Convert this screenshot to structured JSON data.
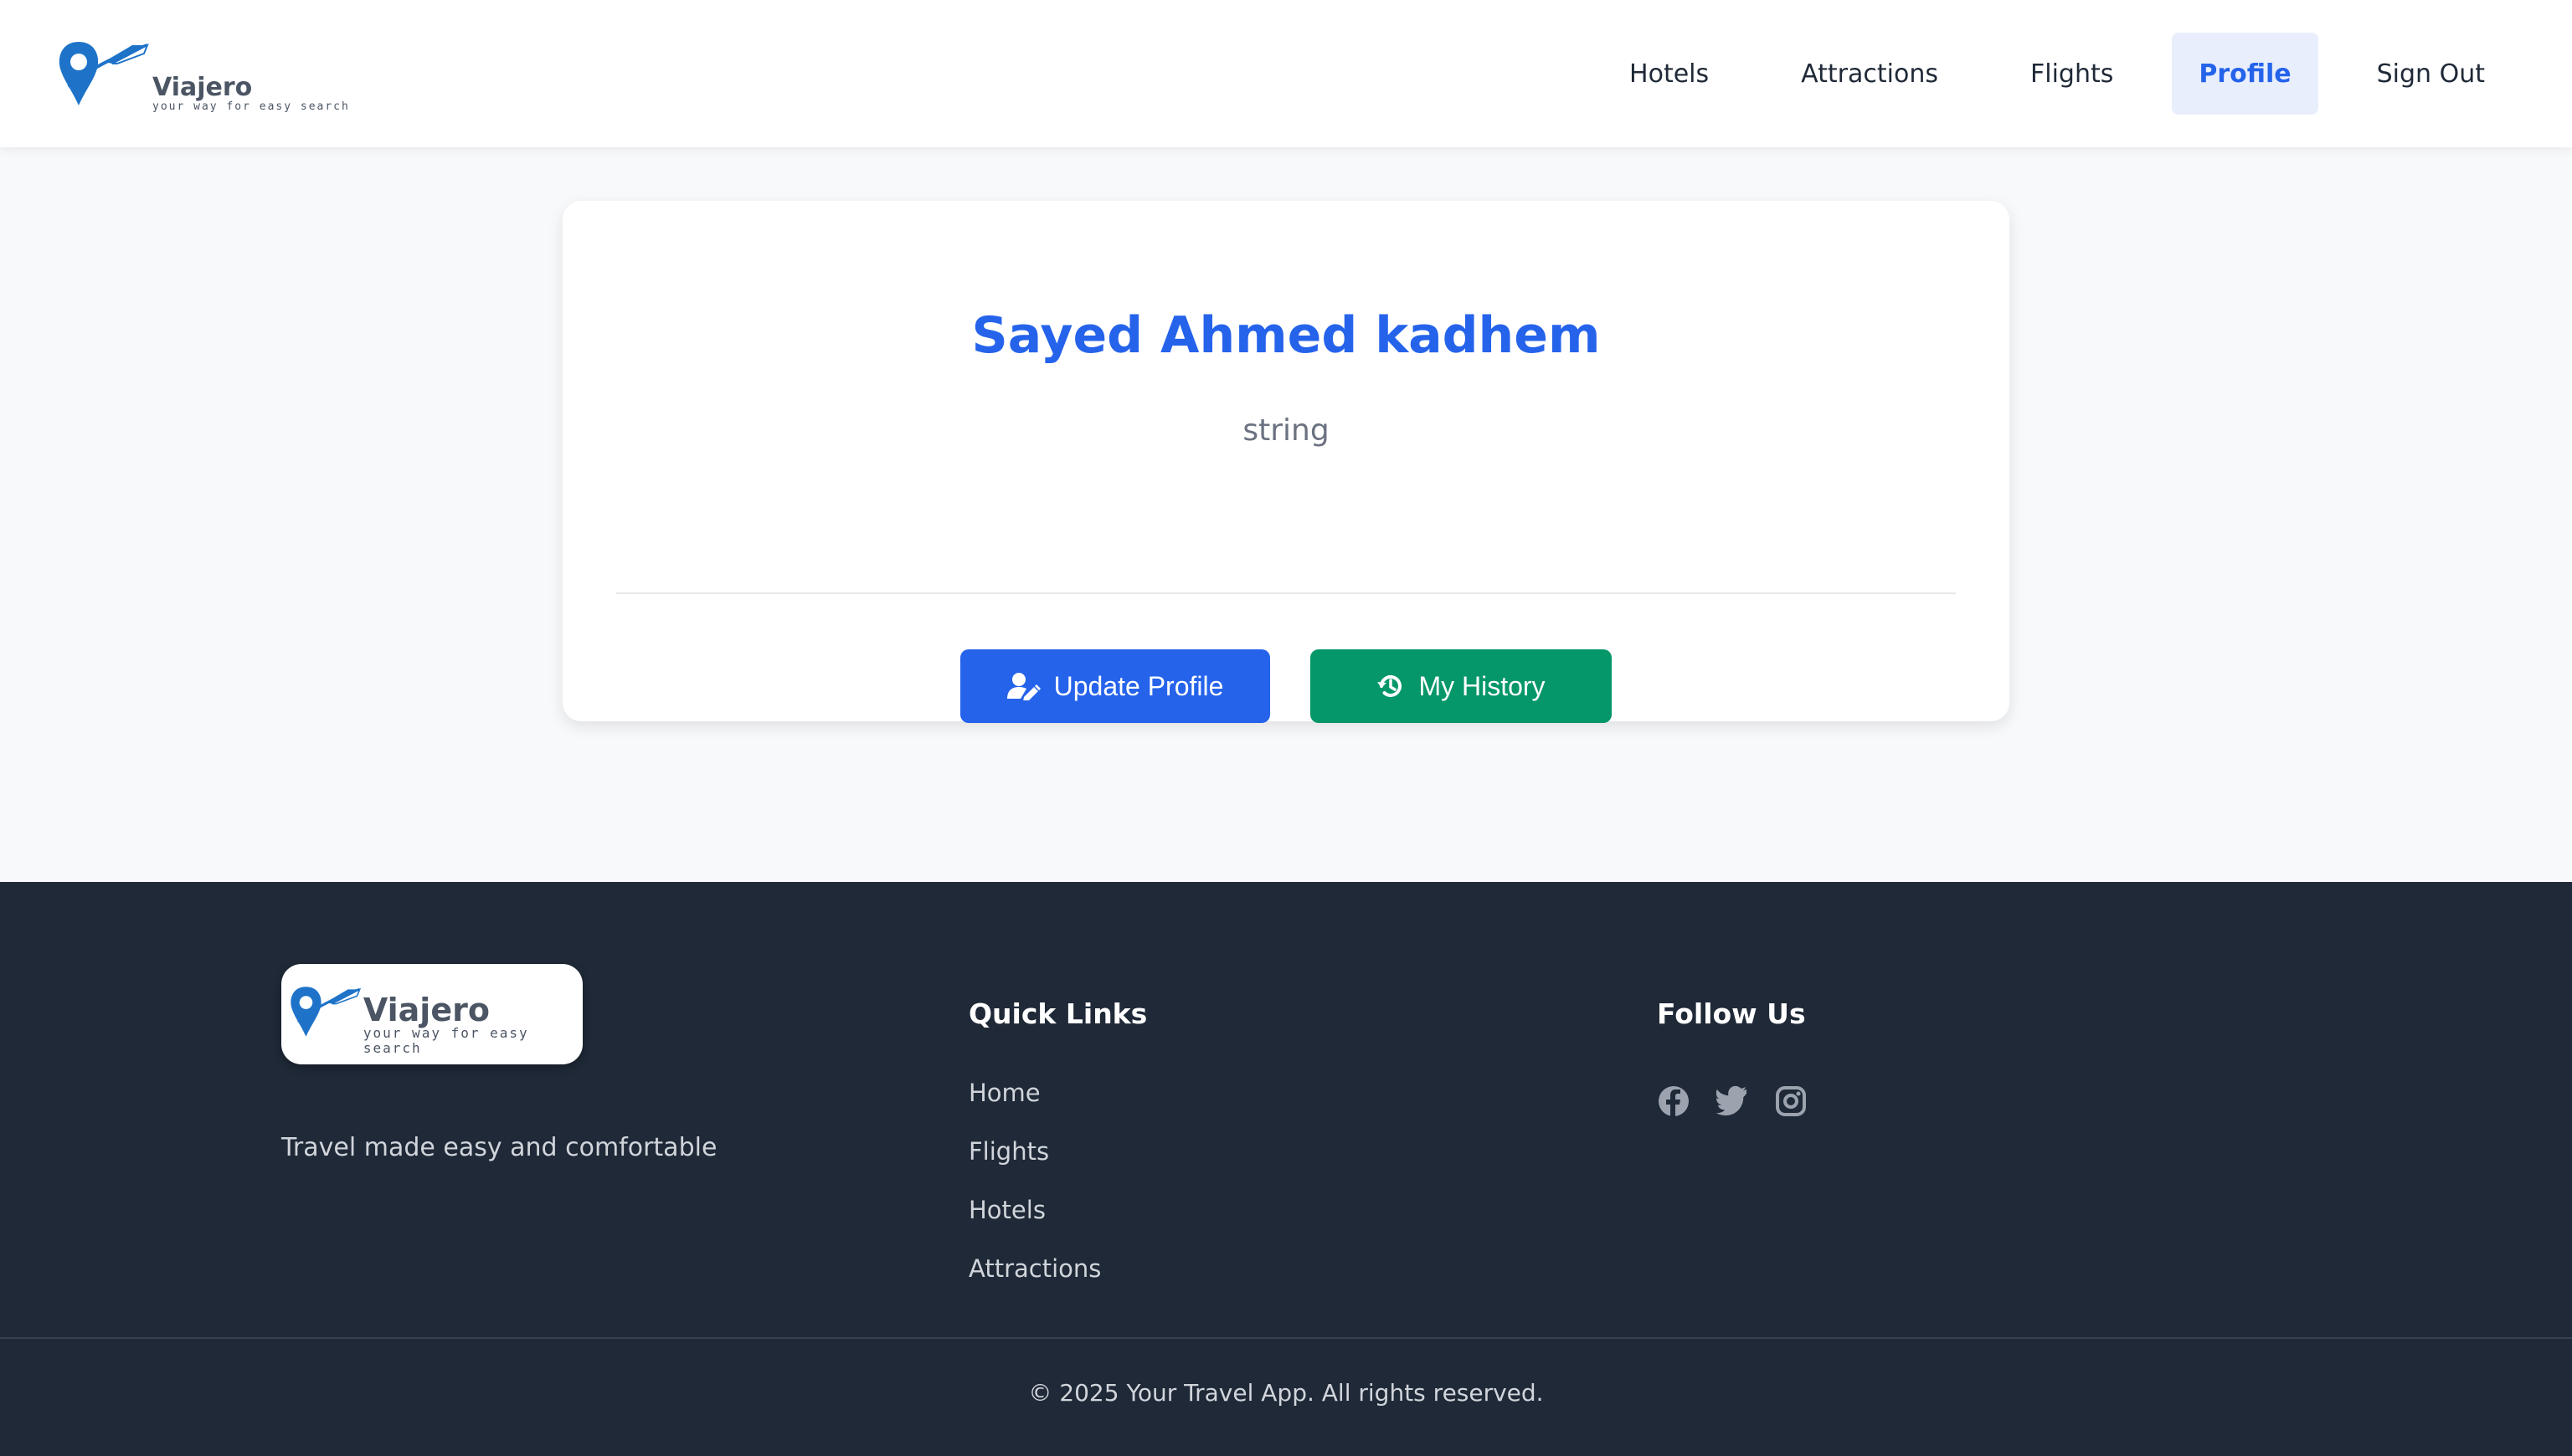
{
  "brand": {
    "name": "Viajero",
    "tagline": "your way for easy search",
    "logo_color": "#1e73c9"
  },
  "nav": {
    "items": [
      {
        "label": "Hotels",
        "active": false
      },
      {
        "label": "Attractions",
        "active": false
      },
      {
        "label": "Flights",
        "active": false
      },
      {
        "label": "Profile",
        "active": true
      },
      {
        "label": "Sign Out",
        "active": false
      }
    ]
  },
  "profile": {
    "name": "Sayed Ahmed kadhem",
    "subtitle": "string",
    "update_label": "Update Profile",
    "history_label": "My History"
  },
  "footer": {
    "tagline": "Travel made easy and comfortable",
    "quick_links_title": "Quick Links",
    "quick_links": [
      "Home",
      "Flights",
      "Hotels",
      "Attractions"
    ],
    "follow_title": "Follow Us",
    "social_icons": [
      "facebook-icon",
      "twitter-icon",
      "instagram-icon"
    ],
    "copyright": "© 2025 Your Travel App. All rights reserved."
  },
  "colors": {
    "accent": "#2563eb",
    "history_button": "#059669",
    "footer_bg": "#1f2937"
  }
}
